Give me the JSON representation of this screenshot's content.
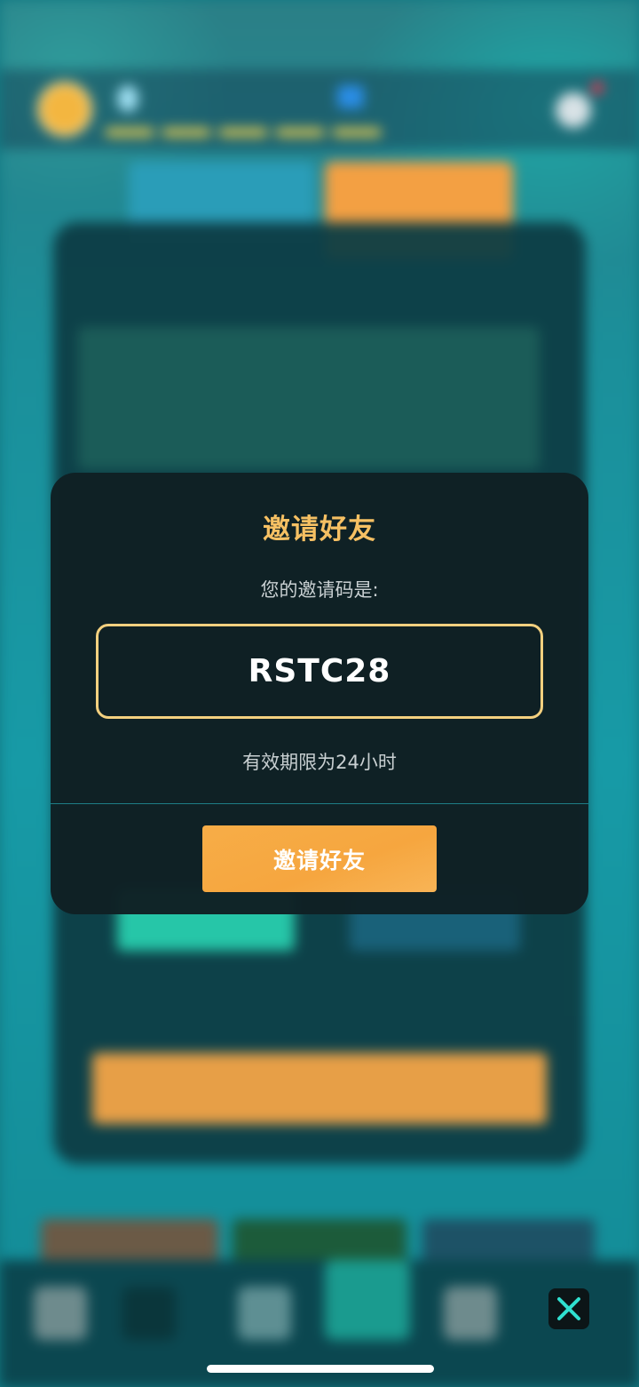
{
  "modal": {
    "title": "邀请好友",
    "code_label": "您的邀请码是:",
    "code_value": "RSTC28",
    "validity_text": "有效期限为24小时",
    "invite_button_label": "邀请好友"
  },
  "colors": {
    "title": "#f6c063",
    "code_border": "#f3d07f",
    "button": "#f6a63f",
    "modal_bg": "#0f2024",
    "close_x": "#2fe0d0"
  },
  "icons": {
    "close": "close-icon"
  }
}
